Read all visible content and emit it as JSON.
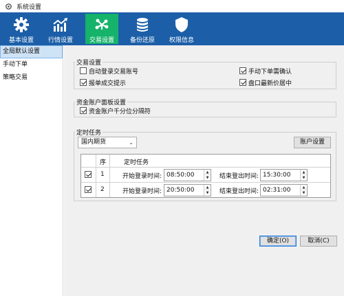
{
  "window": {
    "title": "系统设置",
    "icon": "gear-icon"
  },
  "toolbar": {
    "items": [
      {
        "label": "基本设置",
        "icon": "gear-icon",
        "active": false
      },
      {
        "label": "行情设置",
        "icon": "chart-line-icon",
        "active": false
      },
      {
        "label": "交易设置",
        "icon": "trade-icon",
        "active": true
      },
      {
        "label": "备份还原",
        "icon": "database-icon",
        "active": false
      },
      {
        "label": "权限信息",
        "icon": "shield-icon",
        "active": false
      }
    ],
    "bg_color": "#1c5fa8",
    "active_color": "#16b36b"
  },
  "sidebar": {
    "items": [
      {
        "label": "全局默认设置",
        "selected": true
      },
      {
        "label": "手动下单",
        "selected": false
      },
      {
        "label": "策略交易",
        "selected": false
      }
    ]
  },
  "trade_settings": {
    "title": "交易设置",
    "options": [
      {
        "label": "自动登录交易账号",
        "checked": false
      },
      {
        "label": "手动下单需确认",
        "checked": true
      },
      {
        "label": "报单成交提示",
        "checked": true
      },
      {
        "label": "盘口最新价居中",
        "checked": true
      }
    ]
  },
  "fund_panel": {
    "title": "资金账户面板设置",
    "option": {
      "label": "资金账户千分位分隔符",
      "checked": true
    }
  },
  "scheduled_tasks": {
    "title": "定时任务",
    "market_select": {
      "value": "国内期货"
    },
    "account_button": "账户设置",
    "columns": {
      "seq": "序",
      "task": "定时任务"
    },
    "login_label": "开始登录时间:",
    "logout_label": "结束登出时间:",
    "rows": [
      {
        "checked": true,
        "seq": "1",
        "login_time": "08:50:00",
        "logout_time": "15:30:00"
      },
      {
        "checked": true,
        "seq": "2",
        "login_time": "20:50:00",
        "logout_time": "02:31:00"
      }
    ]
  },
  "dialog_buttons": {
    "ok": "确定(O)",
    "cancel": "取消(C)"
  }
}
